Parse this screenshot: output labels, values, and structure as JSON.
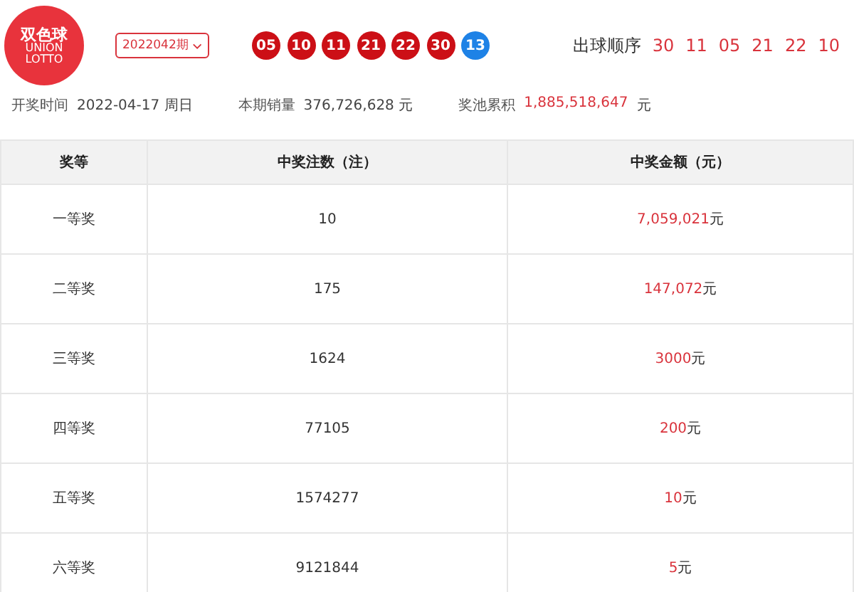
{
  "logo": {
    "title": "双色球",
    "subtitle_1": "UNION",
    "subtitle_2": "LOTTO"
  },
  "issue_select": {
    "value": "2022042期"
  },
  "balls": [
    {
      "number": "05",
      "color": "#cc0f16"
    },
    {
      "number": "10",
      "color": "#cc0f16"
    },
    {
      "number": "11",
      "color": "#cc0f16"
    },
    {
      "number": "21",
      "color": "#cc0f16"
    },
    {
      "number": "22",
      "color": "#cc0f16"
    },
    {
      "number": "30",
      "color": "#cc0f16"
    },
    {
      "number": "13",
      "color": "#1e82e6"
    }
  ],
  "draw_order": {
    "label": "出球顺序",
    "numbers": [
      "30",
      "11",
      "05",
      "21",
      "22",
      "10"
    ]
  },
  "info": [
    {
      "label": "开奖时间",
      "value": "2022-04-17 周日",
      "highlight": false
    },
    {
      "label": "本期销量",
      "value": "376,726,628 元",
      "highlight": false
    },
    {
      "label": "奖池累积",
      "value": "1,885,518,647",
      "unit": "元",
      "highlight": true
    }
  ],
  "table": {
    "columns": [
      "奖等",
      "中奖注数（注）",
      "中奖金额（元）"
    ],
    "rows": [
      {
        "level": "一等奖",
        "count": "10",
        "amount": "7,059,021",
        "unit": "元"
      },
      {
        "level": "二等奖",
        "count": "175",
        "amount": "147,072",
        "unit": "元"
      },
      {
        "level": "三等奖",
        "count": "1624",
        "amount": "3000",
        "unit": "元"
      },
      {
        "level": "四等奖",
        "count": "77105",
        "amount": "200",
        "unit": "元"
      },
      {
        "level": "五等奖",
        "count": "1574277",
        "amount": "10",
        "unit": "元"
      },
      {
        "level": "六等奖",
        "count": "9121844",
        "amount": "5",
        "unit": "元"
      }
    ]
  }
}
